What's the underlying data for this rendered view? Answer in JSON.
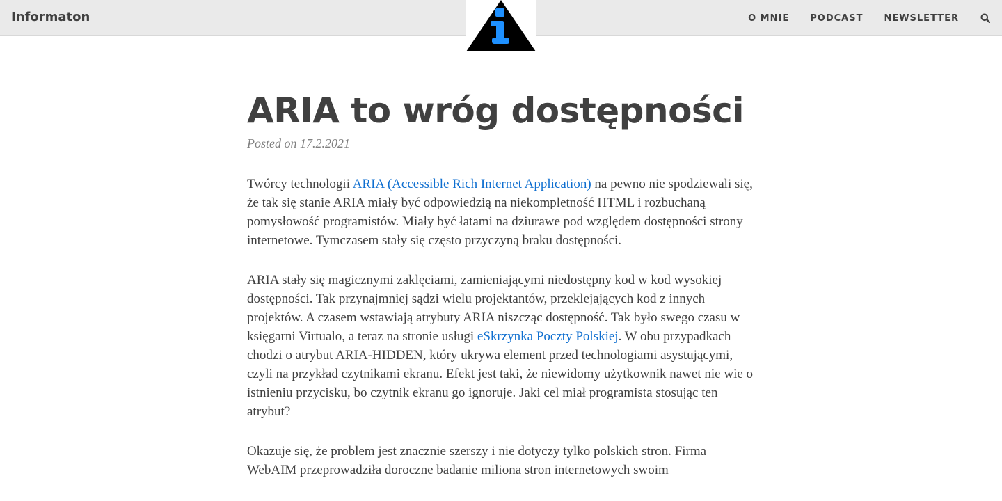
{
  "navbar": {
    "brand": "Informaton",
    "links": [
      "O MNIE",
      "PODCAST",
      "NEWSLETTER"
    ],
    "search_icon": "search-icon",
    "logo_icon": "info-triangle-logo",
    "bg_color": "#eaeaea"
  },
  "post": {
    "title": "ARIA to wróg dostępności",
    "meta": "Posted on 17.2.2021",
    "p1": {
      "before": "Twórcy technologii ",
      "link": "ARIA (Accessible Rich Internet Application)",
      "after": " na pewno nie spodziewali się, że tak się stanie ARIA miały być odpowiedzią na niekompletność HTML i rozbuchaną pomysłowość programistów. Miały być łatami na dziurawe pod względem dostępności strony internetowe. Tymczasem stały się często przyczyną braku dostępności."
    },
    "p2": {
      "before": "ARIA stały się magicznymi zaklęciami, zamieniającymi niedostępny kod w kod wysokiej dostępności. Tak przynajmniej sądzi wielu projektantów, przeklejających kod z innych projektów. A czasem wstawiają atrybuty ARIA niszcząc dostępność. Tak było swego czasu w księgarni Virtualo, a teraz na stronie usługi ",
      "link": "eSkrzynka Poczty Polskiej",
      "after": ". W obu przypadkach chodzi o atrybut ARIA-HIDDEN, który ukrywa element przed technologiami asystującymi, czyli na przykład czytnikami ekranu. Efekt jest taki, że niewidomy użytkownik nawet nie wie o istnieniu przycisku, bo czytnik ekranu go ignoruje. Jaki cel miał programista stosując ten atrybut?"
    },
    "p3": "Okazuje się, że problem jest znacznie szerszy i nie dotyczy tylko polskich stron. Firma WebAIM przeprowadziła doroczne badanie miliona stron internetowych swoim",
    "link_color": "#0f6fd0",
    "text_color": "#404040"
  }
}
